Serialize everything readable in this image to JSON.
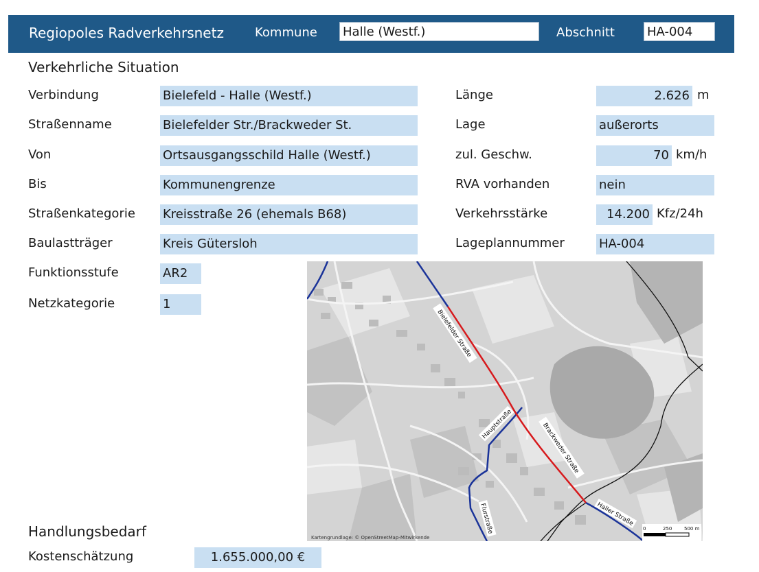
{
  "header": {
    "title": "Regiopoles Radverkehrsnetz",
    "kommune_label": "Kommune",
    "kommune_value": "Halle (Westf.)",
    "abschnitt_label": "Abschnitt",
    "abschnitt_value": "HA-004"
  },
  "situation": {
    "heading": "Verkehrliche Situation",
    "left_fields": [
      {
        "label": "Verbindung",
        "value": "Bielefeld - Halle (Westf.)"
      },
      {
        "label": "Straßenname",
        "value": "Bielefelder Str./Brackweder St."
      },
      {
        "label": "Von",
        "value": "Ortsausgangsschild Halle (Westf.)"
      },
      {
        "label": "Bis",
        "value": "Kommunengrenze"
      },
      {
        "label": "Straßenkategorie",
        "value": "Kreisstraße 26 (ehemals B68)"
      },
      {
        "label": "Baulastträger",
        "value": "Kreis Gütersloh"
      },
      {
        "label": "Funktionsstufe",
        "value": "AR2"
      },
      {
        "label": "Netzkategorie",
        "value": "1"
      }
    ],
    "right_fields": [
      {
        "label": "Länge",
        "value": "2.626",
        "unit": "m"
      },
      {
        "label": "Lage",
        "value": "außerorts",
        "unit": ""
      },
      {
        "label": "zul. Geschw.",
        "value": "70",
        "unit": "km/h"
      },
      {
        "label": "RVA vorhanden",
        "value": "nein",
        "unit": ""
      },
      {
        "label": "Verkehrsstärke",
        "value": "14.200",
        "unit": "Kfz/24h"
      },
      {
        "label": "Lageplannummer",
        "value": "HA-004",
        "unit": ""
      }
    ]
  },
  "handlung": {
    "heading": "Handlungsbedarf",
    "kosten_label": "Kostenschätzung",
    "kosten_value": "1.655.000,00 €"
  },
  "map": {
    "street_labels": [
      "Bielefelder Straße",
      "Brackweder Straße",
      "Hauptstraße",
      "Flurstraße",
      "Haller Straße"
    ],
    "credit": "Kartengrundlage: © OpenStreetMap-Mitwirkende",
    "scale": {
      "zero": "0",
      "mid": "250",
      "end": "500 m"
    },
    "colors": {
      "section_line": "#d7191c",
      "network_line": "#1a3399",
      "boundary_line": "#111111"
    }
  }
}
